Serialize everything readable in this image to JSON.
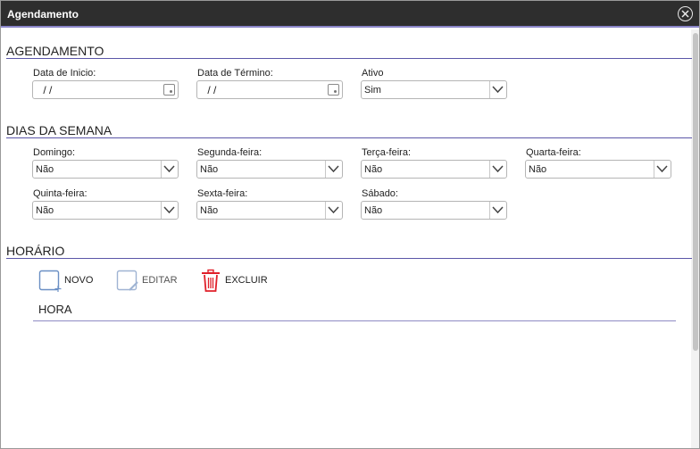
{
  "window": {
    "title": "Agendamento"
  },
  "schedule": {
    "section_title": "AGENDAMENTO",
    "start_date": {
      "label": "Data de Inicio:",
      "value": " / /"
    },
    "end_date": {
      "label": "Data de Término:",
      "value": " / /"
    },
    "active": {
      "label": "Ativo",
      "value": "Sim"
    }
  },
  "weekdays": {
    "section_title": "DIAS DA SEMANA",
    "days": [
      {
        "label": "Domingo:",
        "value": "Não"
      },
      {
        "label": "Segunda-feira:",
        "value": "Não"
      },
      {
        "label": "Terça-feira:",
        "value": "Não"
      },
      {
        "label": "Quarta-feira:",
        "value": "Não"
      },
      {
        "label": "Quinta-feira:",
        "value": "Não"
      },
      {
        "label": "Sexta-feira:",
        "value": "Não"
      },
      {
        "label": "Sábado:",
        "value": "Não"
      }
    ]
  },
  "schedule_time": {
    "section_title": "HORÁRIO",
    "toolbar": {
      "new_label": "NOVO",
      "edit_label": "EDITAR",
      "delete_label": "EXCLUIR"
    },
    "grid": {
      "column_header": "HORA"
    }
  },
  "colors": {
    "titlebar": "#2e2e2e",
    "accent_line": "#5b56a8",
    "icon_blue": "#6a8fc4",
    "delete_red": "#e0202a"
  }
}
